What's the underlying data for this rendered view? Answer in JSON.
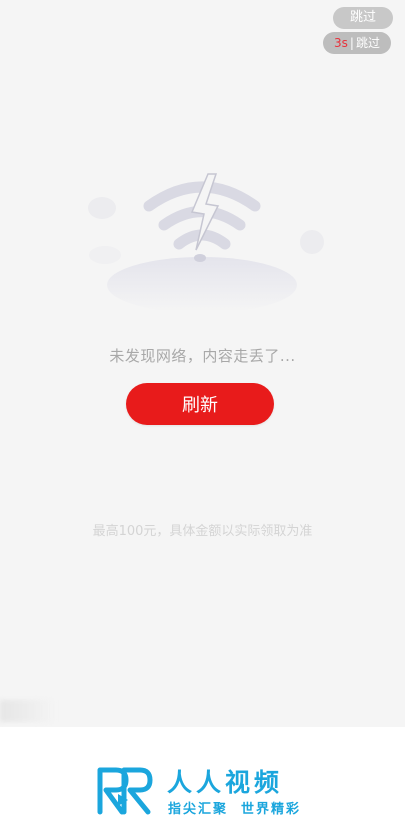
{
  "skip": {
    "label": "跳过"
  },
  "countdown": {
    "seconds": "3s",
    "separator": "|",
    "label": "跳过"
  },
  "error": {
    "message": "未发现网络，内容走丢了..."
  },
  "refresh": {
    "label": "刷新"
  },
  "note": {
    "text": "最高100元，具体金额以实际领取为准"
  },
  "brand": {
    "name": "人人视频",
    "slogan": "指尖汇聚  世界精彩",
    "logo_icon": "rr-logo-icon",
    "color": "#1ba6dd"
  },
  "colors": {
    "accent": "#e81b1b",
    "background": "#f5f5f5"
  }
}
